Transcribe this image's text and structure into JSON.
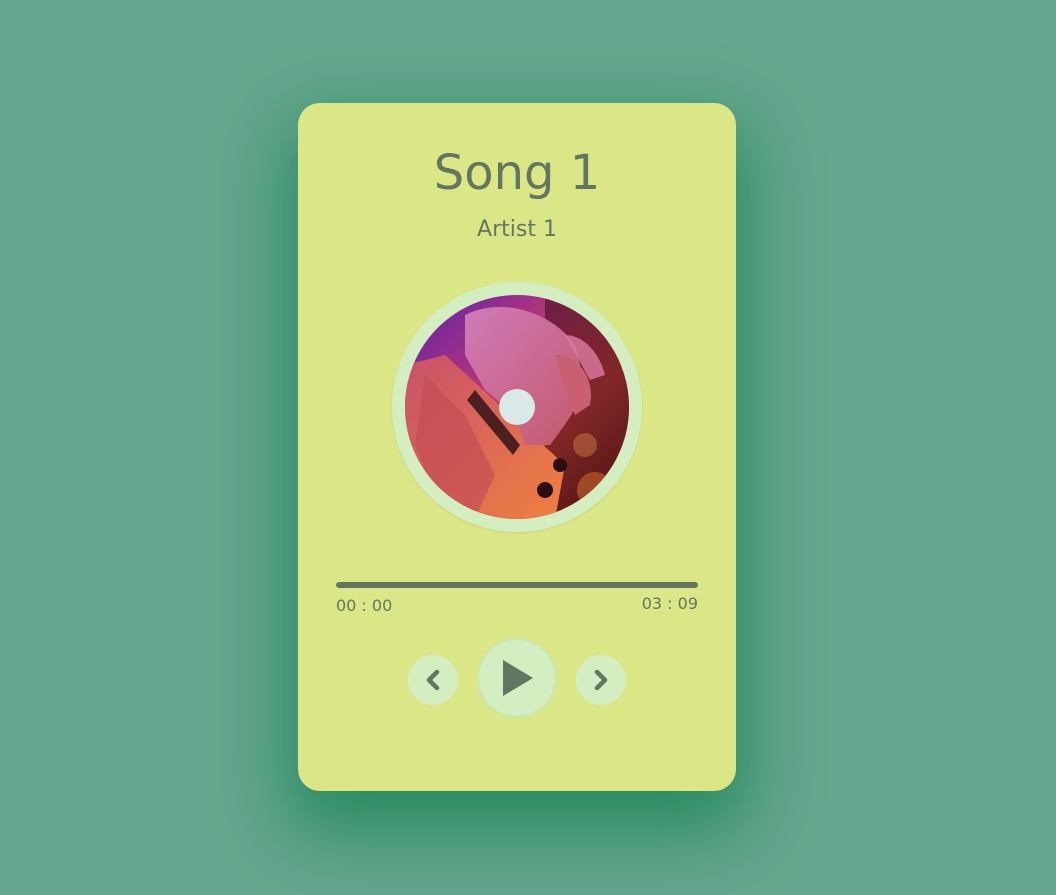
{
  "song": {
    "title": "Song 1",
    "artist": "Artist 1"
  },
  "album_art": {
    "icon": "album-art-guitar"
  },
  "player": {
    "current_time": "00 : 00",
    "total_time": "03 : 09",
    "progress": 0
  },
  "controls": {
    "prev_icon": "chevron-left-icon",
    "play_icon": "play-icon",
    "next_icon": "chevron-right-icon"
  },
  "colors": {
    "background": "#65a68e",
    "card": "#dbe686",
    "text": "#637760",
    "button": "#d3efc2",
    "disc_center": "#d8e9e8"
  }
}
